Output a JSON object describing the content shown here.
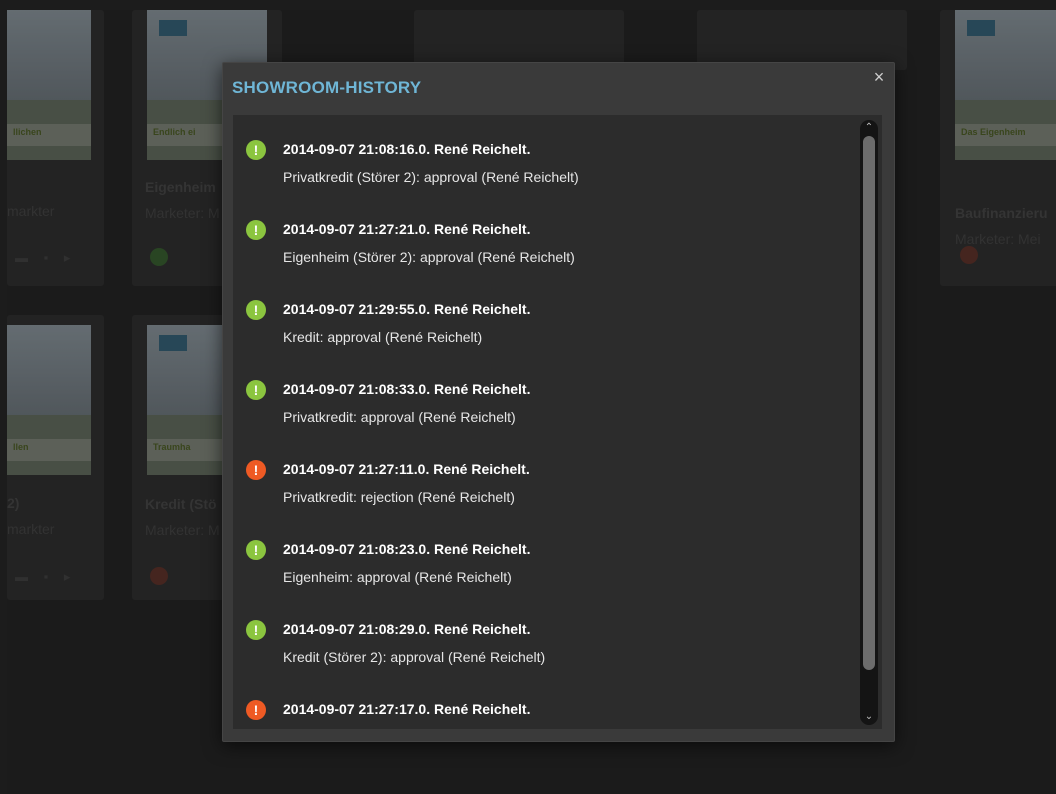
{
  "modal": {
    "title": "SHOWROOM-HISTORY",
    "close_symbol": "×"
  },
  "entries": [
    {
      "status": "approval",
      "icon": "exclamation-icon",
      "color": "#8bc53f",
      "symbol": "!",
      "header": "2014-09-07 21:08:16.0. René Reichelt.",
      "detail": "Privatkredit (Störer 2): approval (René Reichelt)"
    },
    {
      "status": "approval",
      "icon": "exclamation-icon",
      "color": "#8bc53f",
      "symbol": "!",
      "header": "2014-09-07 21:27:21.0. René Reichelt.",
      "detail": "Eigenheim (Störer 2): approval (René Reichelt)"
    },
    {
      "status": "approval",
      "icon": "exclamation-icon",
      "color": "#8bc53f",
      "symbol": "!",
      "header": "2014-09-07 21:29:55.0. René Reichelt.",
      "detail": "Kredit: approval (René Reichelt)"
    },
    {
      "status": "approval",
      "icon": "exclamation-icon",
      "color": "#8bc53f",
      "symbol": "!",
      "header": "2014-09-07 21:08:33.0. René Reichelt.",
      "detail": "Privatkredit: approval (René Reichelt)"
    },
    {
      "status": "rejection",
      "icon": "exclamation-icon",
      "color": "#ee5a24",
      "symbol": "!",
      "header": "2014-09-07 21:27:11.0. René Reichelt.",
      "detail": "Privatkredit: rejection (René Reichelt)"
    },
    {
      "status": "approval",
      "icon": "exclamation-icon",
      "color": "#8bc53f",
      "symbol": "!",
      "header": "2014-09-07 21:08:23.0. René Reichelt.",
      "detail": "Eigenheim: approval (René Reichelt)"
    },
    {
      "status": "approval",
      "icon": "exclamation-icon",
      "color": "#8bc53f",
      "symbol": "!",
      "header": "2014-09-07 21:08:29.0. René Reichelt.",
      "detail": "Kredit (Störer 2): approval (René Reichelt)"
    },
    {
      "status": "rejection",
      "icon": "exclamation-icon",
      "color": "#ee5a24",
      "symbol": "!",
      "header": "2014-09-07 21:27:17.0. René Reichelt.",
      "detail": ""
    }
  ],
  "scrollbar": {
    "up_symbol": "⌃",
    "down_symbol": "⌄"
  },
  "background": {
    "cards": [
      {
        "title": "",
        "subtitle": "markter",
        "banner": "llichen",
        "status": "none",
        "icons": "▬ ▪ ▸"
      },
      {
        "title": "Eigenheim",
        "subtitle": "Marketer: M",
        "banner": "Endlich ei",
        "status": "ok"
      },
      {
        "title": "Baufinanzieru",
        "subtitle": "Marketer: Mei",
        "banner": "Das Eigenheim",
        "status": "no"
      },
      {
        "title": "2)",
        "subtitle": "markter",
        "banner": "llen",
        "status": "none",
        "icons": "▬ ▪ ▸"
      },
      {
        "title": "Kredit (Stö",
        "subtitle": "Marketer: M",
        "banner": "Traumha",
        "status": "no"
      }
    ]
  },
  "colors": {
    "approval": "#8bc53f",
    "rejection": "#ee5a24",
    "title_accent": "#6fb6d6"
  }
}
